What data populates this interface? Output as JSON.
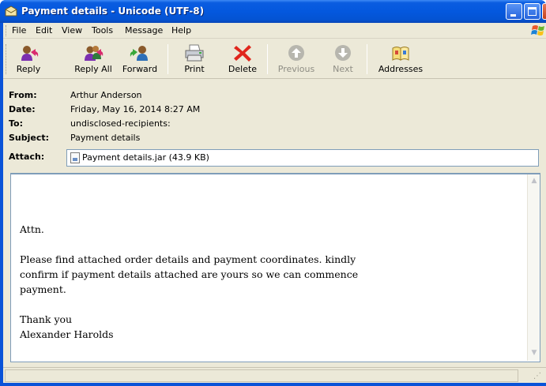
{
  "window": {
    "title": "Payment details - Unicode (UTF-8)"
  },
  "menu": {
    "items": [
      "File",
      "Edit",
      "View",
      "Tools",
      "Message",
      "Help"
    ]
  },
  "toolbar": {
    "reply": "Reply",
    "reply_all": "Reply All",
    "forward": "Forward",
    "print": "Print",
    "delete": "Delete",
    "previous": "Previous",
    "next": "Next",
    "addresses": "Addresses"
  },
  "headers": {
    "from_label": "From:",
    "from": "Arthur Anderson",
    "date_label": "Date:",
    "date": "Friday, May 16, 2014 8:27 AM",
    "to_label": "To:",
    "to": "undisclosed-recipients:",
    "subject_label": "Subject:",
    "subject": "Payment details",
    "attach_label": "Attach:",
    "attachment": "Payment details.jar (43.9 KB)"
  },
  "message": {
    "lines": [
      "Attn.",
      "",
      "Please find attached order details and payment coordinates. kindly",
      "confirm if payment details attached are yours so we can commence",
      "payment.",
      "",
      "Thank you",
      "Alexander Harolds"
    ]
  },
  "icons": {
    "reply": "reply-icon",
    "reply_all": "reply-all-icon",
    "forward": "forward-icon",
    "print": "printer-icon",
    "delete": "delete-x-icon",
    "previous": "previous-arrow-icon",
    "next": "next-arrow-icon",
    "addresses": "address-book-icon"
  },
  "colors": {
    "titlebar": "#0458de",
    "delete_red": "#e0261c",
    "chrome": "#ece9d8"
  }
}
